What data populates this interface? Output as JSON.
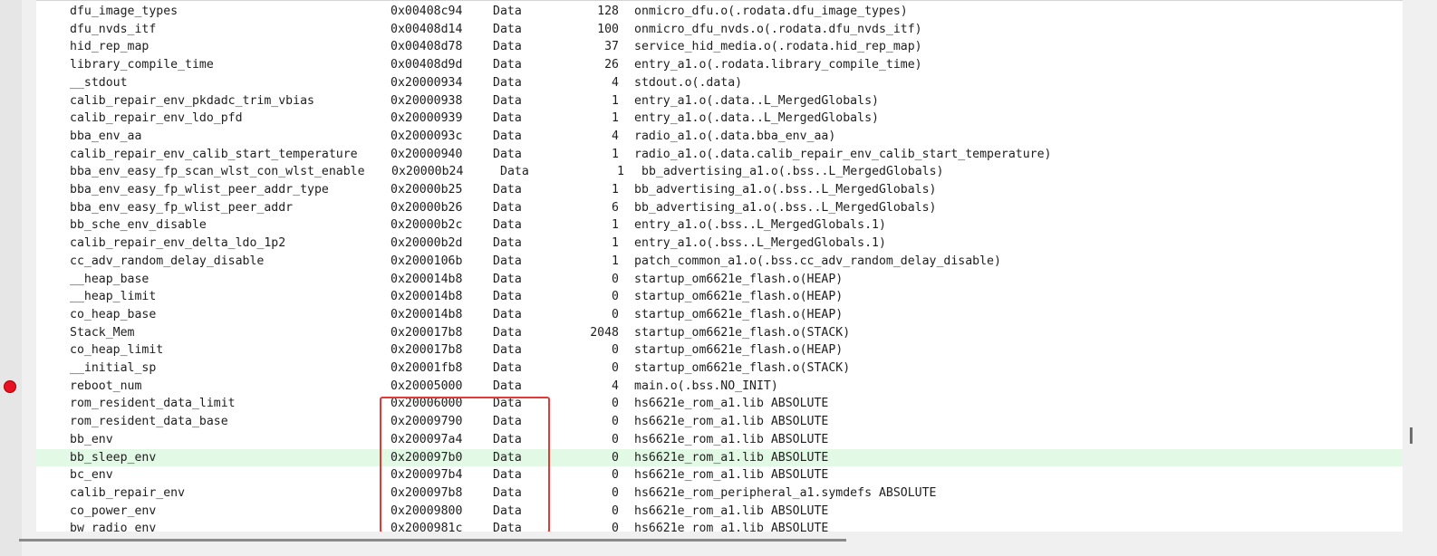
{
  "rows": [
    {
      "symbol": "dfu_image_types",
      "address": "0x00408c94",
      "type": "Data",
      "size": "128",
      "object": "onmicro_dfu.o(.rodata.dfu_image_types)"
    },
    {
      "symbol": "dfu_nvds_itf",
      "address": "0x00408d14",
      "type": "Data",
      "size": "100",
      "object": "onmicro_dfu_nvds.o(.rodata.dfu_nvds_itf)"
    },
    {
      "symbol": "hid_rep_map",
      "address": "0x00408d78",
      "type": "Data",
      "size": "37",
      "object": "service_hid_media.o(.rodata.hid_rep_map)"
    },
    {
      "symbol": "library_compile_time",
      "address": "0x00408d9d",
      "type": "Data",
      "size": "26",
      "object": "entry_a1.o(.rodata.library_compile_time)"
    },
    {
      "symbol": "__stdout",
      "address": "0x20000934",
      "type": "Data",
      "size": "4",
      "object": "stdout.o(.data)"
    },
    {
      "symbol": "calib_repair_env_pkdadc_trim_vbias",
      "address": "0x20000938",
      "type": "Data",
      "size": "1",
      "object": "entry_a1.o(.data..L_MergedGlobals)"
    },
    {
      "symbol": "calib_repair_env_ldo_pfd",
      "address": "0x20000939",
      "type": "Data",
      "size": "1",
      "object": "entry_a1.o(.data..L_MergedGlobals)"
    },
    {
      "symbol": "bba_env_aa",
      "address": "0x2000093c",
      "type": "Data",
      "size": "4",
      "object": "radio_a1.o(.data.bba_env_aa)"
    },
    {
      "symbol": "calib_repair_env_calib_start_temperature",
      "address": "0x20000940",
      "type": "Data",
      "size": "1",
      "object": "radio_a1.o(.data.calib_repair_env_calib_start_temperature)"
    },
    {
      "symbol": "bba_env_easy_fp_scan_wlst_con_wlst_enable",
      "address": "0x20000b24",
      "type": "Data",
      "size": "1",
      "object": "bb_advertising_a1.o(.bss..L_MergedGlobals)"
    },
    {
      "symbol": "bba_env_easy_fp_wlist_peer_addr_type",
      "address": "0x20000b25",
      "type": "Data",
      "size": "1",
      "object": "bb_advertising_a1.o(.bss..L_MergedGlobals)"
    },
    {
      "symbol": "bba_env_easy_fp_wlist_peer_addr",
      "address": "0x20000b26",
      "type": "Data",
      "size": "6",
      "object": "bb_advertising_a1.o(.bss..L_MergedGlobals)"
    },
    {
      "symbol": "bb_sche_env_disable",
      "address": "0x20000b2c",
      "type": "Data",
      "size": "1",
      "object": "entry_a1.o(.bss..L_MergedGlobals.1)"
    },
    {
      "symbol": "calib_repair_env_delta_ldo_1p2",
      "address": "0x20000b2d",
      "type": "Data",
      "size": "1",
      "object": "entry_a1.o(.bss..L_MergedGlobals.1)"
    },
    {
      "symbol": "cc_adv_random_delay_disable",
      "address": "0x2000106b",
      "type": "Data",
      "size": "1",
      "object": "patch_common_a1.o(.bss.cc_adv_random_delay_disable)"
    },
    {
      "symbol": "__heap_base",
      "address": "0x200014b8",
      "type": "Data",
      "size": "0",
      "object": "startup_om6621e_flash.o(HEAP)"
    },
    {
      "symbol": "__heap_limit",
      "address": "0x200014b8",
      "type": "Data",
      "size": "0",
      "object": "startup_om6621e_flash.o(HEAP)"
    },
    {
      "symbol": "co_heap_base",
      "address": "0x200014b8",
      "type": "Data",
      "size": "0",
      "object": "startup_om6621e_flash.o(HEAP)"
    },
    {
      "symbol": "Stack_Mem",
      "address": "0x200017b8",
      "type": "Data",
      "size": "2048",
      "object": "startup_om6621e_flash.o(STACK)"
    },
    {
      "symbol": "co_heap_limit",
      "address": "0x200017b8",
      "type": "Data",
      "size": "0",
      "object": "startup_om6621e_flash.o(HEAP)"
    },
    {
      "symbol": "__initial_sp",
      "address": "0x20001fb8",
      "type": "Data",
      "size": "0",
      "object": "startup_om6621e_flash.o(STACK)"
    },
    {
      "symbol": "reboot_num",
      "address": "0x20005000",
      "type": "Data",
      "size": "4",
      "object": "main.o(.bss.NO_INIT)"
    },
    {
      "symbol": "rom_resident_data_limit",
      "address": "0x20006000",
      "type": "Data",
      "size": "0",
      "object": "hs6621e_rom_a1.lib ABSOLUTE"
    },
    {
      "symbol": "rom_resident_data_base",
      "address": "0x20009790",
      "type": "Data",
      "size": "0",
      "object": "hs6621e_rom_a1.lib ABSOLUTE"
    },
    {
      "symbol": "bb_env",
      "address": "0x200097a4",
      "type": "Data",
      "size": "0",
      "object": "hs6621e_rom_a1.lib ABSOLUTE"
    },
    {
      "symbol": "bb_sleep_env",
      "address": "0x200097b0",
      "type": "Data",
      "size": "0",
      "object": "hs6621e_rom_a1.lib ABSOLUTE"
    },
    {
      "symbol": "bc_env",
      "address": "0x200097b4",
      "type": "Data",
      "size": "0",
      "object": "hs6621e_rom_a1.lib ABSOLUTE"
    },
    {
      "symbol": "calib_repair_env",
      "address": "0x200097b8",
      "type": "Data",
      "size": "0",
      "object": "hs6621e_rom_peripheral_a1.symdefs ABSOLUTE"
    },
    {
      "symbol": "co_power_env",
      "address": "0x20009800",
      "type": "Data",
      "size": "0",
      "object": "hs6621e_rom_a1.lib ABSOLUTE"
    },
    {
      "symbol": "bw_radio_env",
      "address": "0x2000981c",
      "type": "Data",
      "size": "0",
      "object": "hs6621e_rom_a1.lib ABSOLUTE"
    }
  ],
  "highlighted_row": 25,
  "shifted_row": 9,
  "breakpoint_row": 21,
  "colors": {
    "highlight": "#e2fae5",
    "breakpoint": "#e81123",
    "annotation_box": "#e53935"
  }
}
